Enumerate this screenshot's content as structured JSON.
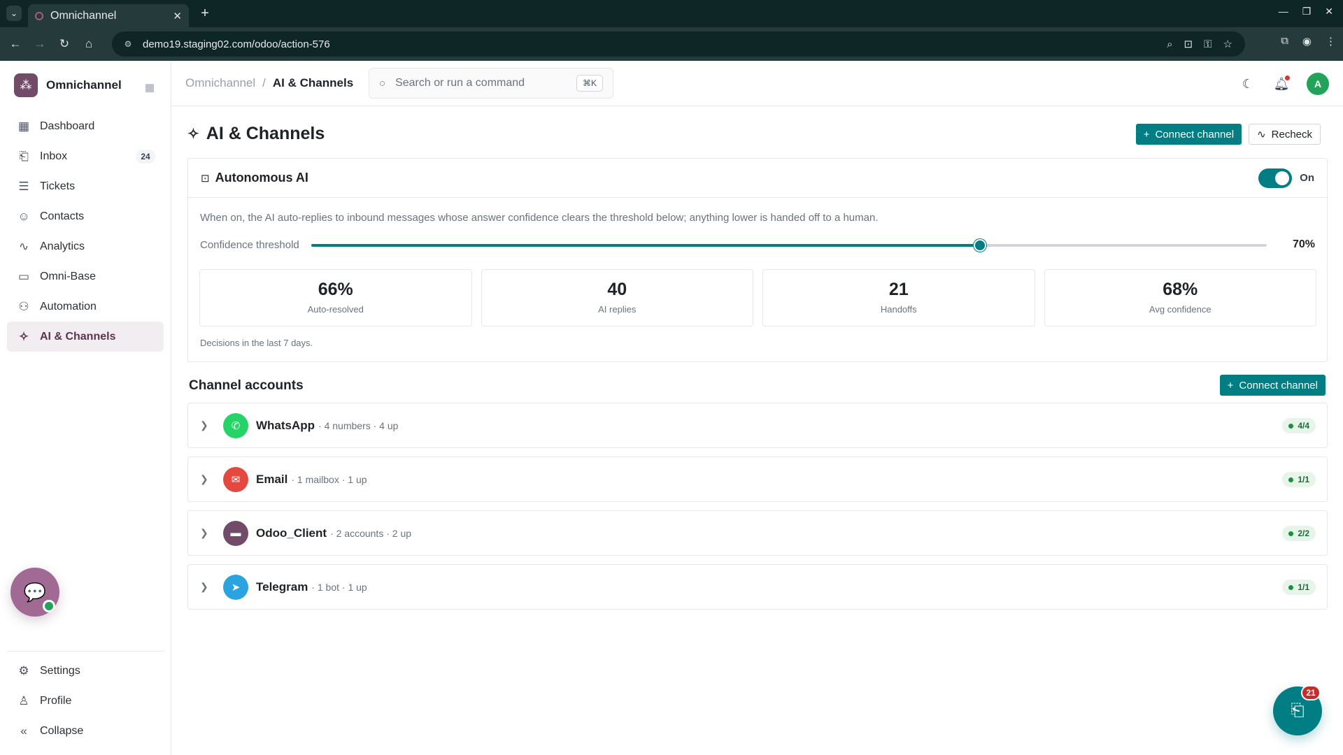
{
  "browser": {
    "tab_title": "Omnichannel",
    "url": "demo19.staging02.com/odoo/action-576"
  },
  "app": {
    "name": "Omnichannel"
  },
  "sidebar": {
    "items": [
      {
        "label": "Dashboard",
        "icon": "dashboard-icon"
      },
      {
        "label": "Inbox",
        "icon": "inbox-icon",
        "badge": "24"
      },
      {
        "label": "Tickets",
        "icon": "tickets-icon"
      },
      {
        "label": "Contacts",
        "icon": "contacts-icon"
      },
      {
        "label": "Analytics",
        "icon": "analytics-icon"
      },
      {
        "label": "Omni-Base",
        "icon": "book-icon"
      },
      {
        "label": "Automation",
        "icon": "automation-icon"
      },
      {
        "label": "AI & Channels",
        "icon": "sparkle-icon",
        "active": true
      }
    ],
    "bottom": [
      {
        "label": "Settings",
        "icon": "gear-icon"
      },
      {
        "label": "Profile",
        "icon": "user-icon"
      },
      {
        "label": "Collapse",
        "icon": "collapse-icon"
      }
    ]
  },
  "header": {
    "breadcrumb_root": "Omnichannel",
    "breadcrumb_current": "AI & Channels",
    "search_placeholder": "Search or run a command",
    "search_shortcut": "⌘K",
    "avatar_initial": "A"
  },
  "page": {
    "title": "AI & Channels",
    "connect_label": "Connect channel",
    "recheck_label": "Recheck"
  },
  "ai": {
    "title": "Autonomous AI",
    "toggle_label": "On",
    "enabled": true,
    "description": "When on, the AI auto-replies to inbound messages whose answer confidence clears the threshold below; anything lower is handed off to a human.",
    "threshold_label": "Confidence threshold",
    "threshold_value": "70%",
    "threshold_fraction": 0.7,
    "stats": [
      {
        "value": "66%",
        "label": "Auto-resolved"
      },
      {
        "value": "40",
        "label": "AI replies"
      },
      {
        "value": "21",
        "label": "Handoffs"
      },
      {
        "value": "68%",
        "label": "Avg confidence"
      }
    ],
    "footnote": "Decisions in the last 7 days."
  },
  "channels": {
    "title": "Channel accounts",
    "connect_label": "Connect channel",
    "items": [
      {
        "name": "WhatsApp",
        "meta": "· 4 numbers · 4 up",
        "status": "4/4",
        "color": "#25d366",
        "icon": "whatsapp-icon"
      },
      {
        "name": "Email",
        "meta": "· 1 mailbox · 1 up",
        "status": "1/1",
        "color": "#e5483f",
        "icon": "mail-icon"
      },
      {
        "name": "Odoo_Client",
        "meta": "· 2 accounts · 2 up",
        "status": "2/2",
        "color": "#714b67",
        "icon": "chat-icon"
      },
      {
        "name": "Telegram",
        "meta": "· 1 bot · 1 up",
        "status": "1/1",
        "color": "#2aa3df",
        "icon": "telegram-icon"
      }
    ]
  },
  "fab": {
    "badge": "21"
  },
  "colors": {
    "primary": "#017e84",
    "brand": "#714b67"
  }
}
